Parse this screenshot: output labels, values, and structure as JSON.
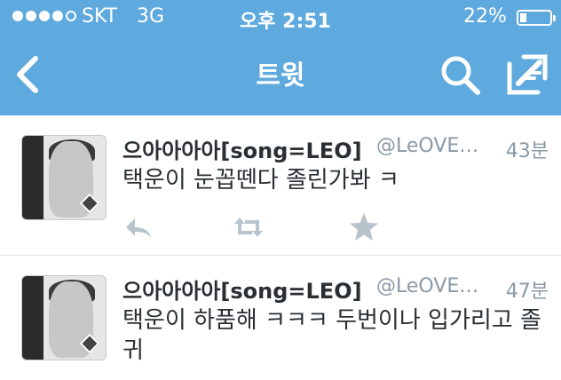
{
  "status_bar": {
    "carrier": "SKT",
    "network": "3G",
    "time": "오후 2:51",
    "battery": "22%",
    "battery_level": 0.22,
    "signal_bars": 4,
    "signal_max": 5
  },
  "nav": {
    "title": "트윗",
    "back_icon": "chevron-left-icon",
    "search_icon": "search-icon",
    "compose_icon": "compose-icon"
  },
  "colors": {
    "header_bg": "#5ea9dd",
    "action_icon": "#b8c3cc",
    "meta_text": "#8899a6"
  },
  "tweets": [
    {
      "name": "으아아아아[song=LEO]",
      "handle": "@LeOVE…",
      "time": "43분",
      "text": "택운이 눈꼽뗀다 졸린가봐 ㅋ"
    },
    {
      "name": "으아아아아[song=LEO]",
      "handle": "@LeOVE…",
      "time": "47분",
      "text": "택운이 하품해 ㅋㅋㅋ 두번이나 입가리고 졸귀"
    }
  ]
}
